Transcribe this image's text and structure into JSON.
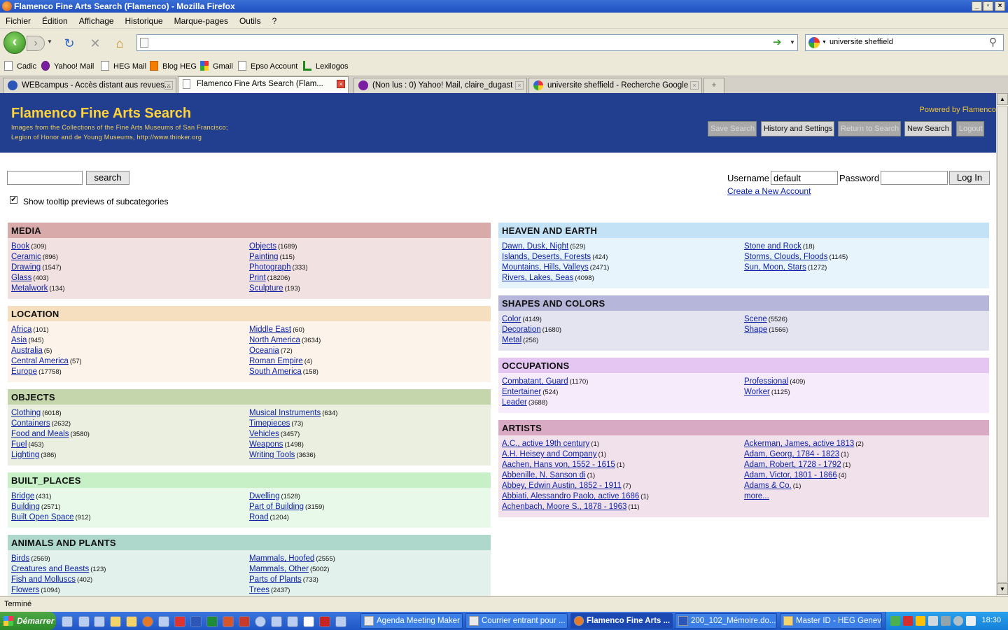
{
  "window": {
    "title": "Flamenco Fine Arts Search (Flamenco) - Mozilla Firefox"
  },
  "menu": [
    "Fichier",
    "Édition",
    "Affichage",
    "Historique",
    "Marque-pages",
    "Outils",
    "?"
  ],
  "navbar": {
    "url": "",
    "search_value": "universite sheffield"
  },
  "bookmarks": [
    "Cadic",
    "Yahoo! Mail",
    "HEG Mail",
    "Blog HEG",
    "Gmail",
    "Epso Account",
    "Lexilogos"
  ],
  "tabs": [
    {
      "label": "WEBcampus - Accès distant aus revues..."
    },
    {
      "label": "Flamenco Fine Arts Search (Flam..."
    },
    {
      "label": "(Non lus : 0) Yahoo! Mail, claire_dugast"
    },
    {
      "label": "universite sheffield - Recherche Google"
    }
  ],
  "site": {
    "title": "Flamenco Fine Arts Search",
    "subtitle1": "Images from the Collections of the Fine Arts Museums of San Francisco;",
    "subtitle2": "Legion of Honor and de Young Museums, http://www.thinker.org",
    "powered": "Powered by Flamenco",
    "buttons": [
      "Save Search",
      "History and Settings",
      "Return to Search",
      "New Search",
      "Logout"
    ]
  },
  "form": {
    "search_label": "search",
    "tooltip_label": "Show tooltip previews of subcategories",
    "username_label": "Username",
    "username_value": "default",
    "password_label": "Password",
    "login_label": "Log In",
    "create_account": "Create a New Account"
  },
  "left_panels": [
    {
      "name": "MEDIA",
      "head": "#d9aaaa",
      "body": "#f2e1e1",
      "col1": [
        [
          "Book",
          "(309)"
        ],
        [
          "Ceramic",
          "(896)"
        ],
        [
          "Drawing",
          "(1547)"
        ],
        [
          "Glass",
          "(403)"
        ],
        [
          "Metalwork",
          "(134)"
        ]
      ],
      "col2": [
        [
          "Objects",
          "(1689)"
        ],
        [
          "Painting",
          "(115)"
        ],
        [
          "Photograph",
          "(333)"
        ],
        [
          "Print",
          "(18206)"
        ],
        [
          "Sculpture",
          "(193)"
        ]
      ]
    },
    {
      "name": "LOCATION",
      "head": "#f6dfbf",
      "body": "#fcf4ea",
      "col1": [
        [
          "Africa",
          "(101)"
        ],
        [
          "Asia",
          "(945)"
        ],
        [
          "Australia",
          "(5)"
        ],
        [
          "Central America",
          "(57)"
        ],
        [
          "Europe",
          "(17758)"
        ]
      ],
      "col2": [
        [
          "Middle East",
          "(60)"
        ],
        [
          "North America",
          "(3634)"
        ],
        [
          "Oceania",
          "(72)"
        ],
        [
          "Roman Empire",
          "(4)"
        ],
        [
          "South America",
          "(158)"
        ]
      ]
    },
    {
      "name": "OBJECTS",
      "head": "#c5d6ac",
      "body": "#eaefe0",
      "col1": [
        [
          "Clothing",
          "(6018)"
        ],
        [
          "Containers",
          "(2632)"
        ],
        [
          "Food and Meals",
          "(3580)"
        ],
        [
          "Fuel",
          "(453)"
        ],
        [
          "Lighting",
          "(386)"
        ]
      ],
      "col2": [
        [
          "Musical Instruments",
          "(634)"
        ],
        [
          "Timepieces",
          "(73)"
        ],
        [
          "Vehicles",
          "(3457)"
        ],
        [
          "Weapons",
          "(1498)"
        ],
        [
          "Writing Tools",
          "(3636)"
        ]
      ]
    },
    {
      "name": "BUILT_PLACES",
      "head": "#c7f0c7",
      "body": "#e9f9e9",
      "col1": [
        [
          "Bridge",
          "(431)"
        ],
        [
          "Building",
          "(2571)"
        ],
        [
          "Built Open Space",
          "(912)"
        ]
      ],
      "col2": [
        [
          "Dwelling",
          "(1528)"
        ],
        [
          "Part of Building",
          "(3159)"
        ],
        [
          "Road",
          "(1204)"
        ]
      ]
    },
    {
      "name": "ANIMALS AND PLANTS",
      "head": "#aed8cc",
      "body": "#e3f1ec",
      "col1": [
        [
          "Birds",
          "(2569)"
        ],
        [
          "Creatures and Beasts",
          "(123)"
        ],
        [
          "Fish and Molluscs",
          "(402)"
        ],
        [
          "Flowers",
          "(1094)"
        ]
      ],
      "col2": [
        [
          "Mammals, Hoofed",
          "(2555)"
        ],
        [
          "Mammals, Other",
          "(5002)"
        ],
        [
          "Parts of Plants",
          "(733)"
        ],
        [
          "Trees",
          "(2437)"
        ]
      ]
    }
  ],
  "right_panels": [
    {
      "name": "HEAVEN AND EARTH",
      "head": "#c4e2f6",
      "body": "#e8f4fc",
      "col1": [
        [
          "Dawn, Dusk, Night",
          "(529)"
        ],
        [
          "Islands, Deserts, Forests",
          "(424)"
        ],
        [
          "Mountains, Hills, Valleys",
          "(2471)"
        ],
        [
          "Rivers, Lakes, Seas",
          "(4098)"
        ]
      ],
      "col2": [
        [
          "Stone and Rock",
          "(18)"
        ],
        [
          "Storms, Clouds, Floods",
          "(1145)"
        ],
        [
          "Sun, Moon, Stars",
          "(1272)"
        ]
      ]
    },
    {
      "name": "SHAPES AND COLORS",
      "head": "#b6b6da",
      "body": "#e4e4f1",
      "col1": [
        [
          "Color",
          "(4149)"
        ],
        [
          "Decoration",
          "(1680)"
        ],
        [
          "Metal",
          "(256)"
        ]
      ],
      "col2": [
        [
          "Scene",
          "(5526)"
        ],
        [
          "Shape",
          "(1566)"
        ]
      ]
    },
    {
      "name": "OCCUPATIONS",
      "head": "#e5c6f2",
      "body": "#f5ebfa",
      "col1": [
        [
          "Combatant, Guard",
          "(1170)"
        ],
        [
          "Entertainer",
          "(524)"
        ],
        [
          "Leader",
          "(3688)"
        ]
      ],
      "col2": [
        [
          "Professional",
          "(409)"
        ],
        [
          "Worker",
          "(1125)"
        ]
      ]
    },
    {
      "name": "ARTISTS",
      "head": "#d9aac4",
      "body": "#f1e1ea",
      "col1": [
        [
          "A.C., active 19th century",
          "(1)"
        ],
        [
          "A.H. Heisey and Company",
          "(1)"
        ],
        [
          "Aachen, Hans von, 1552 - 1615",
          "(1)"
        ],
        [
          "Abbenille, N. Sanson di",
          "(1)"
        ],
        [
          "Abbey, Edwin Austin, 1852 - 1911",
          "(7)"
        ],
        [
          "Abbiati, Alessandro Paolo, active 1686",
          "(1)"
        ],
        [
          "Achenbach, Moore S., 1878 - 1963",
          "(11)"
        ]
      ],
      "col2": [
        [
          "Ackerman, James, active 1813",
          "(2)"
        ],
        [
          "Adam, Georg, 1784 - 1823",
          "(1)"
        ],
        [
          "Adam, Robert, 1728 - 1792",
          "(1)"
        ],
        [
          "Adam, Victor, 1801 - 1866",
          "(4)"
        ],
        [
          "Adams & Co.",
          "(1)"
        ],
        [
          "more...",
          ""
        ]
      ]
    }
  ],
  "status": "Terminé",
  "taskbar": {
    "start": "Démarrer",
    "windows": [
      "Agenda Meeting Maker",
      "Courrier entrant pour ...",
      "Flamenco Fine Arts ...",
      "200_102_Mémoire.do...",
      "Master ID - HEG Geneve"
    ],
    "clock": "18:30"
  }
}
